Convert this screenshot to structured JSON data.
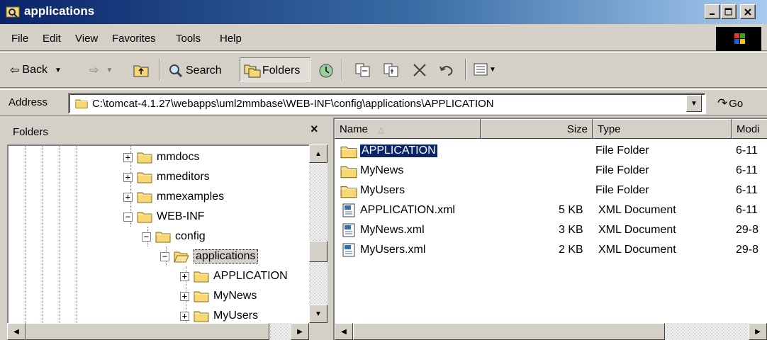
{
  "window": {
    "title": "applications"
  },
  "menu": [
    "File",
    "Edit",
    "View",
    "Favorites",
    "Tools",
    "Help"
  ],
  "toolbar": {
    "back": "Back",
    "search": "Search",
    "folders": "Folders"
  },
  "address": {
    "label": "Address",
    "value": "C:\\tomcat-4.1.27\\webapps\\uml2mmbase\\WEB-INF\\config\\applications\\APPLICATION",
    "go": "Go"
  },
  "folders_pane": {
    "title": "Folders",
    "close": "×",
    "tree": [
      {
        "label": "mmdocs",
        "expander": "+"
      },
      {
        "label": "mmeditors",
        "expander": "+"
      },
      {
        "label": "mmexamples",
        "expander": "+"
      },
      {
        "label": "WEB-INF",
        "expander": "−"
      },
      {
        "label": "config",
        "expander": "−"
      },
      {
        "label": "applications",
        "expander": "−"
      },
      {
        "label": "APPLICATION",
        "expander": "+"
      },
      {
        "label": "MyNews",
        "expander": "+"
      },
      {
        "label": "MyUsers",
        "expander": "+"
      }
    ]
  },
  "files_pane": {
    "columns": {
      "name": "Name",
      "size": "Size",
      "type": "Type",
      "modified": "Modi"
    },
    "rows": [
      {
        "name": "APPLICATION",
        "size": "",
        "type": "File Folder",
        "modified": "6-11"
      },
      {
        "name": "MyNews",
        "size": "",
        "type": "File Folder",
        "modified": "6-11"
      },
      {
        "name": "MyUsers",
        "size": "",
        "type": "File Folder",
        "modified": "6-11"
      },
      {
        "name": "APPLICATION.xml",
        "size": "5 KB",
        "type": "XML Document",
        "modified": "6-11"
      },
      {
        "name": "MyNews.xml",
        "size": "3 KB",
        "type": "XML Document",
        "modified": "29-8"
      },
      {
        "name": "MyUsers.xml",
        "size": "2 KB",
        "type": "XML Document",
        "modified": "29-8"
      }
    ]
  },
  "colors": {
    "titlebar": "#0a246a",
    "chrome": "#d4d0c8",
    "selection": "#0a246a",
    "folder": "#f8d775"
  }
}
